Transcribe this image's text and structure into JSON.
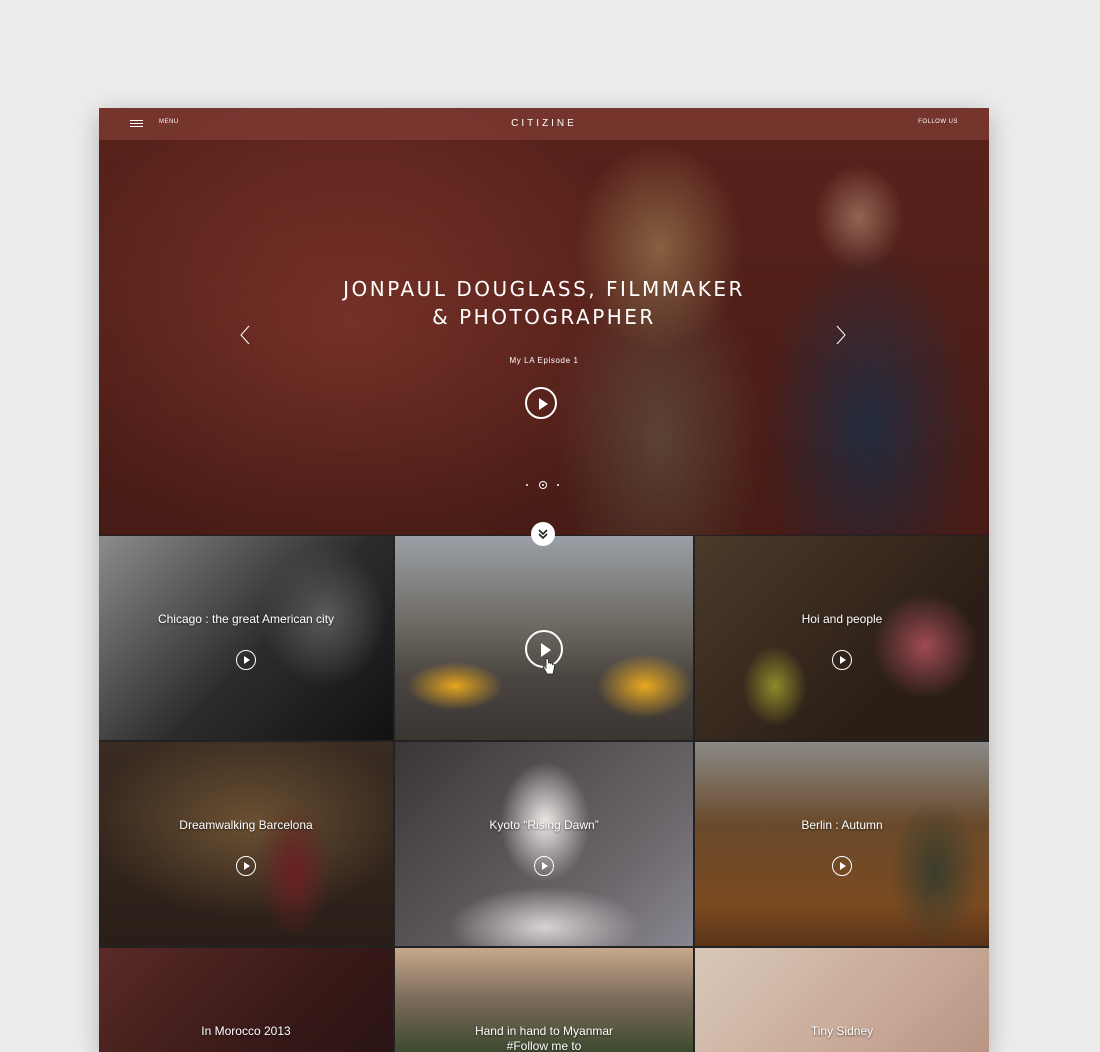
{
  "header": {
    "menu_label": "MENU",
    "brand": "CITIZINE",
    "follow_label": "FOLLOW US"
  },
  "hero": {
    "title_line1": "JONPAUL DOUGLASS, FILMMAKER",
    "title_line2": "& PHOTOGRAPHER",
    "subtitle": "My LA Episode 1",
    "slide_count": 3,
    "active_slide": 2
  },
  "tiles": [
    {
      "caption": "Chicago : the great American city"
    },
    {
      "caption": ""
    },
    {
      "caption": "Hoi and people"
    },
    {
      "caption": "Dreamwalking Barcelona"
    },
    {
      "caption": "Kyoto “Rising Dawn”"
    },
    {
      "caption": "Berlin : Autumn"
    },
    {
      "caption": "In Morocco 2013"
    },
    {
      "caption_line1": "Hand in hand to Myanmar",
      "caption_line2": "#Follow me to"
    },
    {
      "caption": "Tiny Sidney"
    }
  ],
  "icons": {
    "menu": "hamburger-icon",
    "prev": "chevron-left-icon",
    "next": "chevron-right-icon",
    "play": "play-icon",
    "scroll": "double-chevron-down-icon",
    "cursor": "hand-pointer-icon"
  }
}
